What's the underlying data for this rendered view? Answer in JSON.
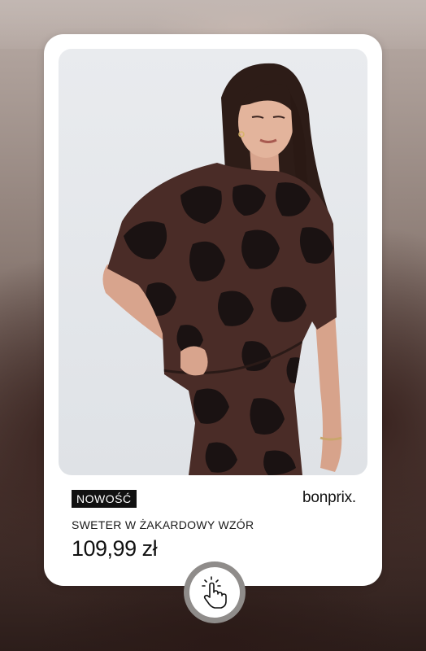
{
  "product": {
    "badge": "NOWOŚĆ",
    "brand": "bonprix.",
    "title": "SWETER W ŻAKARDOWY WZÓR",
    "price": "109,99 zł"
  },
  "icons": {
    "tap": "tap-hand-icon"
  },
  "colors": {
    "badge_bg": "#111111",
    "card_bg": "#ffffff",
    "sweater": "#4a2c27",
    "pattern": "#1a1212"
  }
}
